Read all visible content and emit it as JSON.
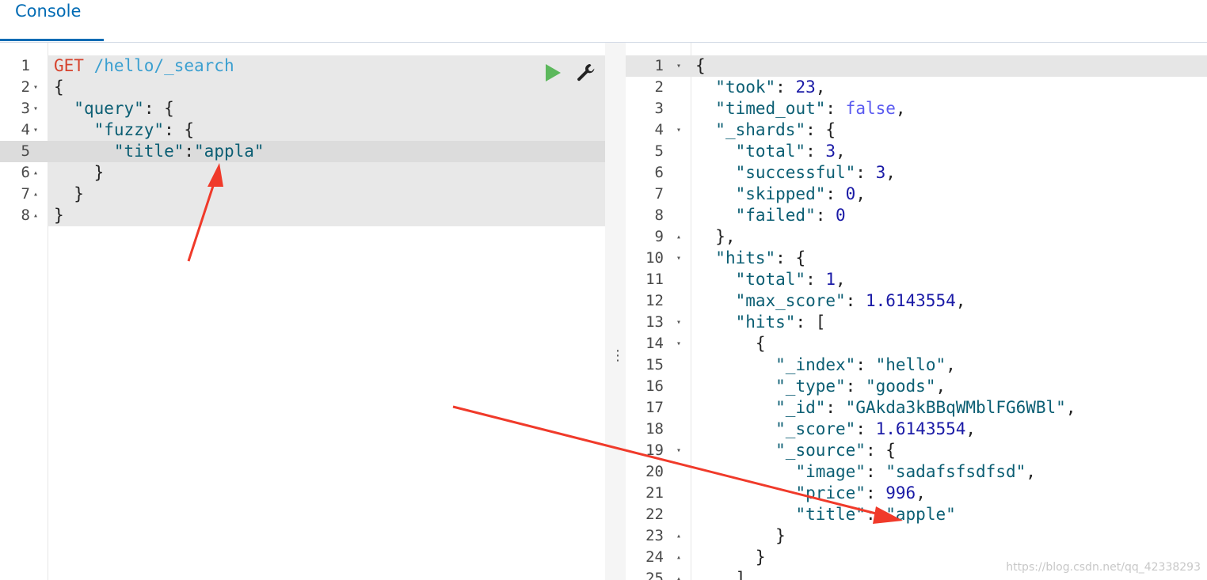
{
  "tabs": [
    {
      "label": "Console"
    }
  ],
  "request": {
    "lines": [
      {
        "n": "1",
        "fold": "",
        "parts": [
          [
            "k-method",
            "GET"
          ],
          [
            "k-punc",
            " "
          ],
          [
            "k-url",
            "/hello/_search"
          ]
        ]
      },
      {
        "n": "2",
        "fold": "▾",
        "parts": [
          [
            "k-punc",
            "{"
          ]
        ]
      },
      {
        "n": "3",
        "fold": "▾",
        "parts": [
          [
            "k-punc",
            "  "
          ],
          [
            "k-key",
            "\"query\""
          ],
          [
            "k-punc",
            ": {"
          ]
        ]
      },
      {
        "n": "4",
        "fold": "▾",
        "parts": [
          [
            "k-punc",
            "    "
          ],
          [
            "k-key",
            "\"fuzzy\""
          ],
          [
            "k-punc",
            ": {"
          ]
        ]
      },
      {
        "n": "5",
        "fold": "",
        "parts": [
          [
            "k-punc",
            "      "
          ],
          [
            "k-key",
            "\"title\""
          ],
          [
            "k-punc",
            ":"
          ],
          [
            "k-str",
            "\"appla\""
          ]
        ]
      },
      {
        "n": "6",
        "fold": "▴",
        "parts": [
          [
            "k-punc",
            "    }"
          ]
        ]
      },
      {
        "n": "7",
        "fold": "▴",
        "parts": [
          [
            "k-punc",
            "  }"
          ]
        ]
      },
      {
        "n": "8",
        "fold": "▴",
        "parts": [
          [
            "k-punc",
            "}"
          ]
        ]
      }
    ]
  },
  "response": {
    "lines": [
      {
        "n": "1",
        "fold": "▾",
        "parts": [
          [
            "k-punc",
            "{"
          ]
        ]
      },
      {
        "n": "2",
        "fold": "",
        "parts": [
          [
            "k-punc",
            "  "
          ],
          [
            "k-key",
            "\"took\""
          ],
          [
            "k-punc",
            ": "
          ],
          [
            "k-num",
            "23"
          ],
          [
            "k-punc",
            ","
          ]
        ]
      },
      {
        "n": "3",
        "fold": "",
        "parts": [
          [
            "k-punc",
            "  "
          ],
          [
            "k-key",
            "\"timed_out\""
          ],
          [
            "k-punc",
            ": "
          ],
          [
            "k-bool",
            "false"
          ],
          [
            "k-punc",
            ","
          ]
        ]
      },
      {
        "n": "4",
        "fold": "▾",
        "parts": [
          [
            "k-punc",
            "  "
          ],
          [
            "k-key",
            "\"_shards\""
          ],
          [
            "k-punc",
            ": {"
          ]
        ]
      },
      {
        "n": "5",
        "fold": "",
        "parts": [
          [
            "k-punc",
            "    "
          ],
          [
            "k-key",
            "\"total\""
          ],
          [
            "k-punc",
            ": "
          ],
          [
            "k-num",
            "3"
          ],
          [
            "k-punc",
            ","
          ]
        ]
      },
      {
        "n": "6",
        "fold": "",
        "parts": [
          [
            "k-punc",
            "    "
          ],
          [
            "k-key",
            "\"successful\""
          ],
          [
            "k-punc",
            ": "
          ],
          [
            "k-num",
            "3"
          ],
          [
            "k-punc",
            ","
          ]
        ]
      },
      {
        "n": "7",
        "fold": "",
        "parts": [
          [
            "k-punc",
            "    "
          ],
          [
            "k-key",
            "\"skipped\""
          ],
          [
            "k-punc",
            ": "
          ],
          [
            "k-num",
            "0"
          ],
          [
            "k-punc",
            ","
          ]
        ]
      },
      {
        "n": "8",
        "fold": "",
        "parts": [
          [
            "k-punc",
            "    "
          ],
          [
            "k-key",
            "\"failed\""
          ],
          [
            "k-punc",
            ": "
          ],
          [
            "k-num",
            "0"
          ]
        ]
      },
      {
        "n": "9",
        "fold": "▴",
        "parts": [
          [
            "k-punc",
            "  },"
          ]
        ]
      },
      {
        "n": "10",
        "fold": "▾",
        "parts": [
          [
            "k-punc",
            "  "
          ],
          [
            "k-key",
            "\"hits\""
          ],
          [
            "k-punc",
            ": {"
          ]
        ]
      },
      {
        "n": "11",
        "fold": "",
        "parts": [
          [
            "k-punc",
            "    "
          ],
          [
            "k-key",
            "\"total\""
          ],
          [
            "k-punc",
            ": "
          ],
          [
            "k-num",
            "1"
          ],
          [
            "k-punc",
            ","
          ]
        ]
      },
      {
        "n": "12",
        "fold": "",
        "parts": [
          [
            "k-punc",
            "    "
          ],
          [
            "k-key",
            "\"max_score\""
          ],
          [
            "k-punc",
            ": "
          ],
          [
            "k-num",
            "1.6143554"
          ],
          [
            "k-punc",
            ","
          ]
        ]
      },
      {
        "n": "13",
        "fold": "▾",
        "parts": [
          [
            "k-punc",
            "    "
          ],
          [
            "k-key",
            "\"hits\""
          ],
          [
            "k-punc",
            ": ["
          ]
        ]
      },
      {
        "n": "14",
        "fold": "▾",
        "parts": [
          [
            "k-punc",
            "      {"
          ]
        ]
      },
      {
        "n": "15",
        "fold": "",
        "parts": [
          [
            "k-punc",
            "        "
          ],
          [
            "k-key",
            "\"_index\""
          ],
          [
            "k-punc",
            ": "
          ],
          [
            "k-str",
            "\"hello\""
          ],
          [
            "k-punc",
            ","
          ]
        ]
      },
      {
        "n": "16",
        "fold": "",
        "parts": [
          [
            "k-punc",
            "        "
          ],
          [
            "k-key",
            "\"_type\""
          ],
          [
            "k-punc",
            ": "
          ],
          [
            "k-str",
            "\"goods\""
          ],
          [
            "k-punc",
            ","
          ]
        ]
      },
      {
        "n": "17",
        "fold": "",
        "parts": [
          [
            "k-punc",
            "        "
          ],
          [
            "k-key",
            "\"_id\""
          ],
          [
            "k-punc",
            ": "
          ],
          [
            "k-str",
            "\"GAkda3kBBqWMblFG6WBl\""
          ],
          [
            "k-punc",
            ","
          ]
        ]
      },
      {
        "n": "18",
        "fold": "",
        "parts": [
          [
            "k-punc",
            "        "
          ],
          [
            "k-key",
            "\"_score\""
          ],
          [
            "k-punc",
            ": "
          ],
          [
            "k-num",
            "1.6143554"
          ],
          [
            "k-punc",
            ","
          ]
        ]
      },
      {
        "n": "19",
        "fold": "▾",
        "parts": [
          [
            "k-punc",
            "        "
          ],
          [
            "k-key",
            "\"_source\""
          ],
          [
            "k-punc",
            ": {"
          ]
        ]
      },
      {
        "n": "20",
        "fold": "",
        "parts": [
          [
            "k-punc",
            "          "
          ],
          [
            "k-key",
            "\"image\""
          ],
          [
            "k-punc",
            ": "
          ],
          [
            "k-str",
            "\"sadafsfsdfsd\""
          ],
          [
            "k-punc",
            ","
          ]
        ]
      },
      {
        "n": "21",
        "fold": "",
        "parts": [
          [
            "k-punc",
            "          "
          ],
          [
            "k-key",
            "\"price\""
          ],
          [
            "k-punc",
            ": "
          ],
          [
            "k-num",
            "996"
          ],
          [
            "k-punc",
            ","
          ]
        ]
      },
      {
        "n": "22",
        "fold": "",
        "parts": [
          [
            "k-punc",
            "          "
          ],
          [
            "k-key",
            "\"title\""
          ],
          [
            "k-punc",
            ": "
          ],
          [
            "k-str",
            "\"apple\""
          ]
        ]
      },
      {
        "n": "23",
        "fold": "▴",
        "parts": [
          [
            "k-punc",
            "        }"
          ]
        ]
      },
      {
        "n": "24",
        "fold": "▴",
        "parts": [
          [
            "k-punc",
            "      }"
          ]
        ]
      },
      {
        "n": "25",
        "fold": "▴",
        "parts": [
          [
            "k-punc",
            "    ]"
          ]
        ]
      }
    ]
  },
  "toolbar": {
    "play_icon": "play-icon",
    "wrench_icon": "wrench-icon"
  },
  "resizer_glyph": "⋮",
  "watermark": "https://blog.csdn.net/qq_42338293",
  "colors": {
    "accent": "#006bb4",
    "arrow": "#f03a2a",
    "play": "#5cb85c"
  }
}
